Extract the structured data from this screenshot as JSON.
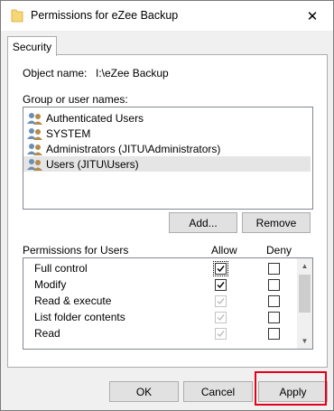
{
  "window": {
    "title": "Permissions for eZee Backup",
    "close_glyph": "✕"
  },
  "tab": {
    "label": "Security"
  },
  "object": {
    "label": "Object name:",
    "value": "I:\\eZee Backup"
  },
  "groups": {
    "label": "Group or user names:",
    "items": [
      {
        "name": "Authenticated Users"
      },
      {
        "name": "SYSTEM"
      },
      {
        "name": "Administrators (JITU\\Administrators)"
      },
      {
        "name": "Users (JITU\\Users)",
        "selected": true
      }
    ]
  },
  "buttons": {
    "add": "Add...",
    "remove": "Remove",
    "ok": "OK",
    "cancel": "Cancel",
    "apply": "Apply"
  },
  "permissions": {
    "label": "Permissions for Users",
    "allow_label": "Allow",
    "deny_label": "Deny",
    "rows": [
      {
        "name": "Full control",
        "allow": true,
        "allow_disabled": false,
        "deny": false
      },
      {
        "name": "Modify",
        "allow": true,
        "allow_disabled": false,
        "deny": false
      },
      {
        "name": "Read & execute",
        "allow": true,
        "allow_disabled": true,
        "deny": false
      },
      {
        "name": "List folder contents",
        "allow": true,
        "allow_disabled": true,
        "deny": false
      },
      {
        "name": "Read",
        "allow": true,
        "allow_disabled": true,
        "deny": false
      }
    ]
  },
  "colors": {
    "highlight": "#e5001b",
    "folder": "#f7d674"
  }
}
